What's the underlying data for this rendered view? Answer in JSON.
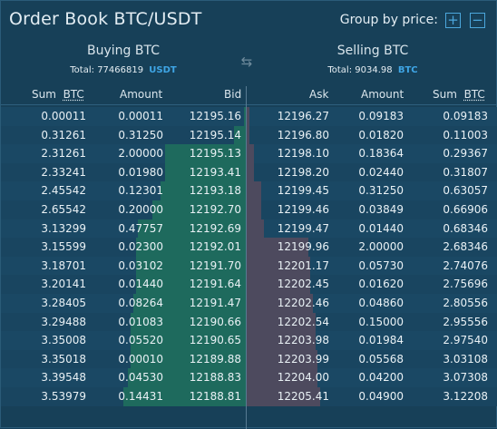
{
  "title": "Order Book BTC/USDT",
  "group_label": "Group by price:",
  "group_plus": "+",
  "group_minus": "−",
  "buy": {
    "heading": "Buying BTC",
    "total_label": "Total:",
    "total_value": "77466819",
    "total_currency": "USDT"
  },
  "sell": {
    "heading": "Selling BTC",
    "total_label": "Total:",
    "total_value": "9034.98",
    "total_currency": "BTC"
  },
  "swap_icon": "⇆",
  "columns": {
    "sum": "Sum",
    "sum_unit": "BTC",
    "amount": "Amount",
    "bid": "Bid",
    "ask": "Ask",
    "amount2": "Amount",
    "sum2": "Sum",
    "sum2_unit": "BTC"
  },
  "bids": [
    {
      "sum": "0.00011",
      "amount": "0.00011",
      "price": "12195.16",
      "depth": 0.0
    },
    {
      "sum": "0.31261",
      "amount": "0.31250",
      "price": "12195.14",
      "depth": 0.05
    },
    {
      "sum": "2.31261",
      "amount": "2.00000",
      "price": "12195.13",
      "depth": 0.33
    },
    {
      "sum": "2.33241",
      "amount": "0.01980",
      "price": "12193.41",
      "depth": 0.33
    },
    {
      "sum": "2.45542",
      "amount": "0.12301",
      "price": "12193.18",
      "depth": 0.35
    },
    {
      "sum": "2.65542",
      "amount": "0.20000",
      "price": "12192.70",
      "depth": 0.38
    },
    {
      "sum": "3.13299",
      "amount": "0.47757",
      "price": "12192.69",
      "depth": 0.44
    },
    {
      "sum": "3.15599",
      "amount": "0.02300",
      "price": "12192.01",
      "depth": 0.45
    },
    {
      "sum": "3.18701",
      "amount": "0.03102",
      "price": "12191.70",
      "depth": 0.45
    },
    {
      "sum": "3.20141",
      "amount": "0.01440",
      "price": "12191.64",
      "depth": 0.45
    },
    {
      "sum": "3.28405",
      "amount": "0.08264",
      "price": "12191.47",
      "depth": 0.46
    },
    {
      "sum": "3.29488",
      "amount": "0.01083",
      "price": "12190.66",
      "depth": 0.47
    },
    {
      "sum": "3.35008",
      "amount": "0.05520",
      "price": "12190.65",
      "depth": 0.47
    },
    {
      "sum": "3.35018",
      "amount": "0.00010",
      "price": "12189.88",
      "depth": 0.47
    },
    {
      "sum": "3.39548",
      "amount": "0.04530",
      "price": "12188.83",
      "depth": 0.48
    },
    {
      "sum": "3.53979",
      "amount": "0.14431",
      "price": "12188.81",
      "depth": 0.5
    }
  ],
  "asks": [
    {
      "price": "12196.27",
      "amount": "0.09183",
      "sum": "0.09183",
      "depth": 0.01
    },
    {
      "price": "12196.80",
      "amount": "0.01820",
      "sum": "0.11003",
      "depth": 0.01
    },
    {
      "price": "12198.10",
      "amount": "0.18364",
      "sum": "0.29367",
      "depth": 0.03
    },
    {
      "price": "12198.20",
      "amount": "0.02440",
      "sum": "0.31807",
      "depth": 0.03
    },
    {
      "price": "12199.45",
      "amount": "0.31250",
      "sum": "0.63057",
      "depth": 0.06
    },
    {
      "price": "12199.46",
      "amount": "0.03849",
      "sum": "0.66906",
      "depth": 0.06
    },
    {
      "price": "12199.47",
      "amount": "0.01440",
      "sum": "0.68346",
      "depth": 0.07
    },
    {
      "price": "12199.96",
      "amount": "2.00000",
      "sum": "2.68346",
      "depth": 0.25
    },
    {
      "price": "12201.17",
      "amount": "0.05730",
      "sum": "2.74076",
      "depth": 0.26
    },
    {
      "price": "12202.45",
      "amount": "0.01620",
      "sum": "2.75696",
      "depth": 0.26
    },
    {
      "price": "12202.46",
      "amount": "0.04860",
      "sum": "2.80556",
      "depth": 0.27
    },
    {
      "price": "12202.54",
      "amount": "0.15000",
      "sum": "2.95556",
      "depth": 0.28
    },
    {
      "price": "12203.98",
      "amount": "0.01984",
      "sum": "2.97540",
      "depth": 0.28
    },
    {
      "price": "12203.99",
      "amount": "0.05568",
      "sum": "3.03108",
      "depth": 0.29
    },
    {
      "price": "12204.00",
      "amount": "0.04200",
      "sum": "3.07308",
      "depth": 0.29
    },
    {
      "price": "12205.41",
      "amount": "0.04900",
      "sum": "3.12208",
      "depth": 0.3
    }
  ],
  "colors": {
    "bid_bar": "#1e6a5d",
    "ask_bar": "#4d4a5e",
    "accent": "#3fa6e6"
  }
}
